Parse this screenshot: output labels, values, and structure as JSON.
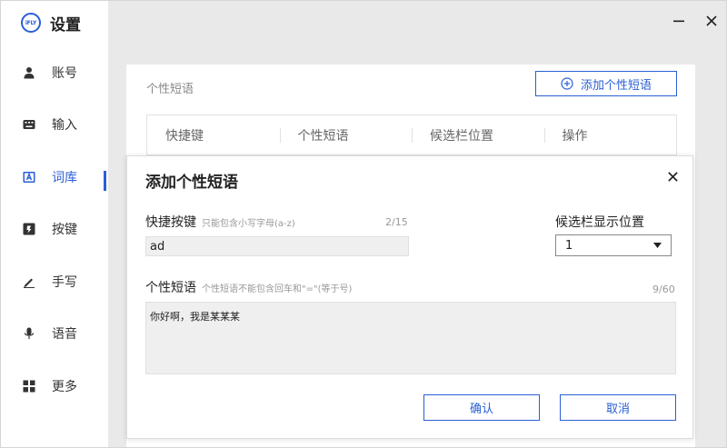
{
  "app": {
    "logo_text": "iFLY",
    "title": "设置"
  },
  "window": {
    "minimize_glyph": "—",
    "close_glyph": "×"
  },
  "sidebar": {
    "items": [
      {
        "label": "账号",
        "icon": "user-icon"
      },
      {
        "label": "输入",
        "icon": "keyboard-icon"
      },
      {
        "label": "词库",
        "icon": "dictionary-icon",
        "active": true
      },
      {
        "label": "按键",
        "icon": "key-icon"
      },
      {
        "label": "手写",
        "icon": "pen-icon"
      },
      {
        "label": "语音",
        "icon": "microphone-icon"
      },
      {
        "label": "更多",
        "icon": "grid-icon"
      }
    ]
  },
  "panel": {
    "title": "个性短语",
    "add_button": "添加个性短语",
    "columns": [
      "快捷键",
      "个性短语",
      "候选栏位置",
      "操作"
    ]
  },
  "dialog": {
    "title": "添加个性短语",
    "shortcut": {
      "label": "快捷按键",
      "hint": "只能包含小写字母(a-z)",
      "counter": "2/15",
      "value": "ad"
    },
    "position": {
      "label": "候选栏显示位置",
      "value": "1"
    },
    "phrase": {
      "label": "个性短语",
      "hint": "个性短语不能包含回车和\"=\"(等于号)",
      "counter": "9/60",
      "value": "你好啊，我是某某某"
    },
    "confirm_button": "确认",
    "cancel_button": "取消"
  },
  "colors": {
    "accent": "#2b5fd6",
    "main_bg": "#e9e9e9"
  }
}
